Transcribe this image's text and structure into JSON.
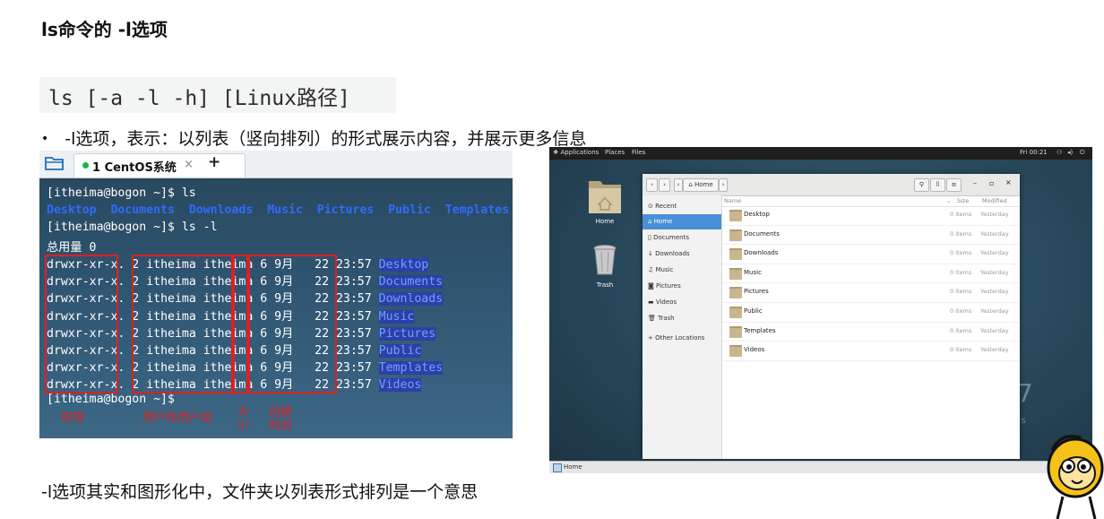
{
  "title": "ls命令的 -l选项",
  "command": "ls [-a -l -h] [Linux路径]",
  "bullet": "-l选项，表示：以列表（竖向排列）的形式展示内容，并展示更多信息",
  "footer": "-l选项其实和图形化中，文件夹以列表形式排列是一个意思",
  "terminal": {
    "tab_label": "1 CentOS系统",
    "tab_close": "×",
    "tab_add": "+",
    "line1_prompt": "[itheima@bogon ~]$ ls",
    "ls_output": [
      "Desktop",
      "Documents",
      "Downloads",
      "Music",
      "Pictures",
      "Public",
      "Templates",
      "Videos"
    ],
    "line3_prompt": "[itheima@bogon ~]$ ls -l",
    "total": "总用量 0",
    "rows": [
      {
        "perm": "drwxr-xr-x.",
        "links": "2",
        "user": "itheima",
        "group": "itheima",
        "size": "6",
        "month": "9月",
        "day": "22",
        "time": "23:57",
        "name": "Desktop"
      },
      {
        "perm": "drwxr-xr-x.",
        "links": "2",
        "user": "itheima",
        "group": "itheima",
        "size": "6",
        "month": "9月",
        "day": "22",
        "time": "23:57",
        "name": "Documents"
      },
      {
        "perm": "drwxr-xr-x.",
        "links": "2",
        "user": "itheima",
        "group": "itheima",
        "size": "6",
        "month": "9月",
        "day": "22",
        "time": "23:57",
        "name": "Downloads"
      },
      {
        "perm": "drwxr-xr-x.",
        "links": "2",
        "user": "itheima",
        "group": "itheima",
        "size": "6",
        "month": "9月",
        "day": "22",
        "time": "23:57",
        "name": "Music"
      },
      {
        "perm": "drwxr-xr-x.",
        "links": "2",
        "user": "itheima",
        "group": "itheima",
        "size": "6",
        "month": "9月",
        "day": "22",
        "time": "23:57",
        "name": "Pictures"
      },
      {
        "perm": "drwxr-xr-x.",
        "links": "2",
        "user": "itheima",
        "group": "itheima",
        "size": "6",
        "month": "9月",
        "day": "22",
        "time": "23:57",
        "name": "Public"
      },
      {
        "perm": "drwxr-xr-x.",
        "links": "2",
        "user": "itheima",
        "group": "itheima",
        "size": "6",
        "month": "9月",
        "day": "22",
        "time": "23:57",
        "name": "Templates"
      },
      {
        "perm": "drwxr-xr-x.",
        "links": "2",
        "user": "itheima",
        "group": "itheima",
        "size": "6",
        "month": "9月",
        "day": "22",
        "time": "23:57",
        "name": "Videos"
      }
    ],
    "last_prompt": "[itheima@bogon ~]$",
    "annotations": {
      "perm": "权限",
      "owner": "用户和用户组",
      "size": "大\n小",
      "mtime": "创建\n时间"
    },
    "annotation_color": "#e02020"
  },
  "desktop": {
    "topbar": {
      "applications": "Applications",
      "places": "Places",
      "files": "Files",
      "clock": "Fri 00:21"
    },
    "icons": {
      "home": "Home",
      "trash": "Trash"
    },
    "filewin": {
      "path": "Home",
      "sidebar": [
        "Recent",
        "Home",
        "Documents",
        "Downloads",
        "Music",
        "Pictures",
        "Videos",
        "Trash",
        "Other Locations"
      ],
      "sidebar_active": "Home",
      "columns": {
        "name": "Name",
        "size": "Size",
        "modified": "Modified"
      },
      "files": [
        {
          "name": "Desktop",
          "size": "0 items",
          "modified": "Yesterday"
        },
        {
          "name": "Documents",
          "size": "0 items",
          "modified": "Yesterday"
        },
        {
          "name": "Downloads",
          "size": "0 items",
          "modified": "Yesterday"
        },
        {
          "name": "Music",
          "size": "0 items",
          "modified": "Yesterday"
        },
        {
          "name": "Pictures",
          "size": "0 items",
          "modified": "Yesterday"
        },
        {
          "name": "Public",
          "size": "0 items",
          "modified": "Yesterday"
        },
        {
          "name": "Templates",
          "size": "0 items",
          "modified": "Yesterday"
        },
        {
          "name": "Videos",
          "size": "0 items",
          "modified": "Yesterday"
        }
      ]
    },
    "taskbar": "Home",
    "bg_digit": "7",
    "bg_text": "r o s"
  }
}
